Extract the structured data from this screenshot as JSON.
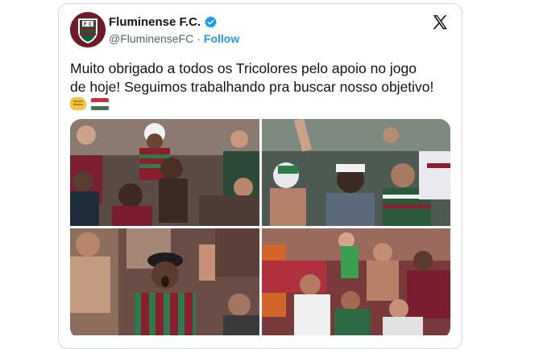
{
  "tweet": {
    "display_name": "Fluminense F.C.",
    "handle": "@FluminenseFC",
    "separator": "·",
    "follow_label": "Follow",
    "text_line1": "Muito obrigado a todos os Tricolores pelo apoio no jogo",
    "text_line2": "de hoje! Seguimos trabalhando pra buscar nosso objetivo!",
    "emojis": [
      "fist-emoji",
      "hungary-flag-emoji"
    ],
    "verified": true
  },
  "icons": {
    "logo": "x-logo-icon",
    "verified": "verified-badge-icon",
    "avatar": "fluminense-crest"
  },
  "media": {
    "photos": [
      {
        "name": "photo-fans-child-on-shoulders"
      },
      {
        "name": "photo-fans-cheering-arms-up"
      },
      {
        "name": "photo-fan-shouting-cap"
      },
      {
        "name": "photo-crowd-celebrating"
      }
    ]
  },
  "colors": {
    "follow": "#1d9bf0",
    "verified": "#1d9bf0",
    "club_grena": "#7a1d2e",
    "club_green": "#006437",
    "border": "#cfd9de"
  }
}
